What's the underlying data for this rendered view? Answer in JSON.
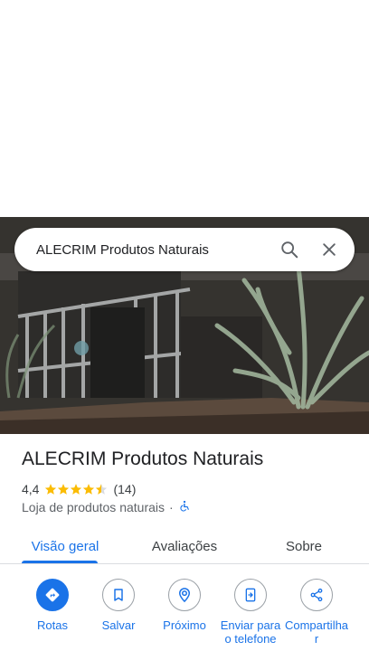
{
  "search": {
    "query": "ALECRIM Produtos Naturais",
    "search_icon": "search-icon",
    "clear_icon": "close-icon"
  },
  "place": {
    "name": "ALECRIM Produtos Naturais",
    "rating": "4,4",
    "rating_value": 4.4,
    "review_count": "(14)",
    "category": "Loja de produtos naturais",
    "separator": "·",
    "accessibility_icon": "wheelchair-icon"
  },
  "tabs": [
    {
      "label": "Visão geral",
      "active": true
    },
    {
      "label": "Avaliações",
      "active": false
    },
    {
      "label": "Sobre",
      "active": false
    }
  ],
  "actions": [
    {
      "label": "Rotas",
      "icon": "directions-icon"
    },
    {
      "label": "Salvar",
      "icon": "bookmark-icon"
    },
    {
      "label": "Próximo",
      "icon": "nearby-icon"
    },
    {
      "label": "Enviar para o telefone",
      "icon": "send-to-phone-icon"
    },
    {
      "label": "Compartilhar",
      "icon": "share-icon"
    }
  ],
  "colors": {
    "accent": "#1a73e8",
    "star": "#fbbc04"
  }
}
